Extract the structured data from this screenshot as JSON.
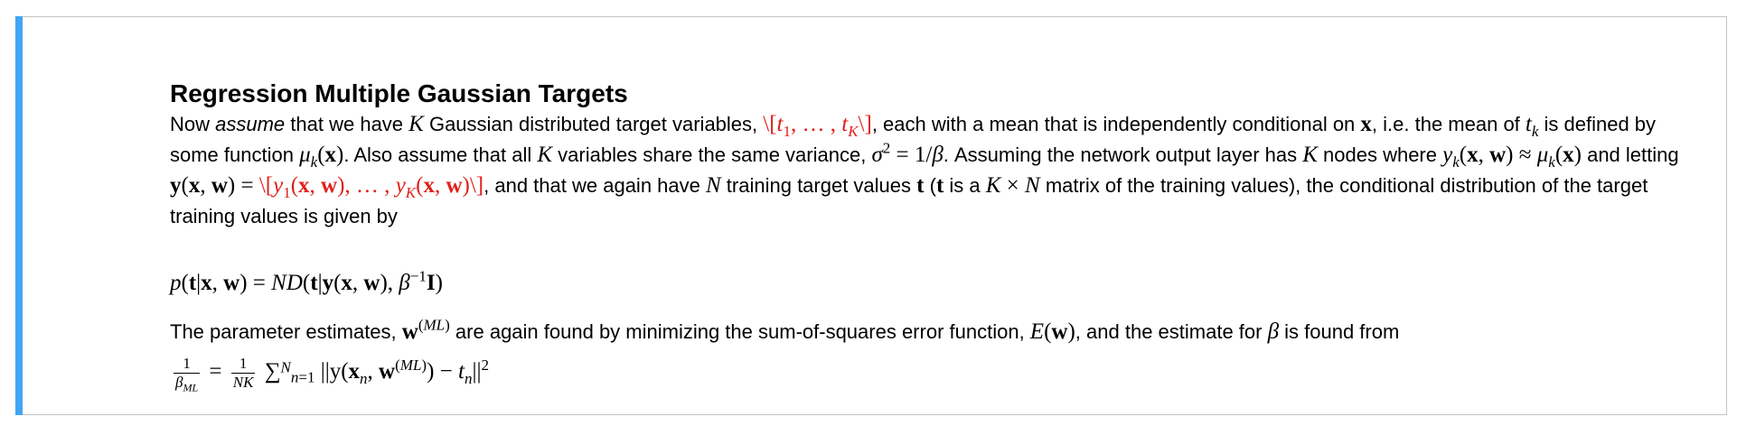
{
  "cell": {
    "accent_color": "#42a5f5",
    "border_color": "#c4c4c4"
  },
  "heading": "Regression Multiple Gaussian Targets",
  "paragraph1": {
    "t1": "Now ",
    "t2": "assume",
    "t3": " that we have ",
    "t4": " Gaussian distributed target variables, ",
    "t5": ", each with a mean that is independently conditional on ",
    "t6": ", i.e. the mean of ",
    "t7": " is defined by some function ",
    "t8": ". Also assume that all ",
    "t9": " variables share the same variance, ",
    "t10": ". Assuming the network output layer has ",
    "t11": " nodes where ",
    "t12": " and letting ",
    "t13": ", and that we again have ",
    "t14": " training target values ",
    "t15": " (",
    "t16": " is a ",
    "t17": " matrix of the training values), the conditional distribution of the target training values is given by"
  },
  "paragraph2": {
    "t1": "The parameter estimates, ",
    "t2": " are again found by minimizing the sum-of-squares error function, ",
    "t3": ", and the estimate for ",
    "t4": " is found from"
  },
  "math": {
    "K": "K",
    "N": "N",
    "x": "x",
    "t": "t",
    "unrendered_targets": "\\[t₁, … , t_K\\]",
    "unrendered_y": "\\[y₁(x, w), … , y_K(x, w)\\]",
    "t_k": "t_k",
    "mu_k_x": "μ_k(x)",
    "variance": "σ² = 1/β",
    "approx": "y_k(x, w) ≈ μ_k(x)",
    "y_def": "y(x, w) =",
    "K_times_N": "K × N",
    "likelihood": "p(t|x, w) = ND(t|y(x, w), β⁻¹I)",
    "w_ML": "w^(ML)",
    "E_w": "E(w)",
    "beta": "β",
    "beta_eq": "1/β_ML = 1/NK Σ_{n=1}^{N} ||y(x_n, w^(ML)) − t_n||²"
  }
}
